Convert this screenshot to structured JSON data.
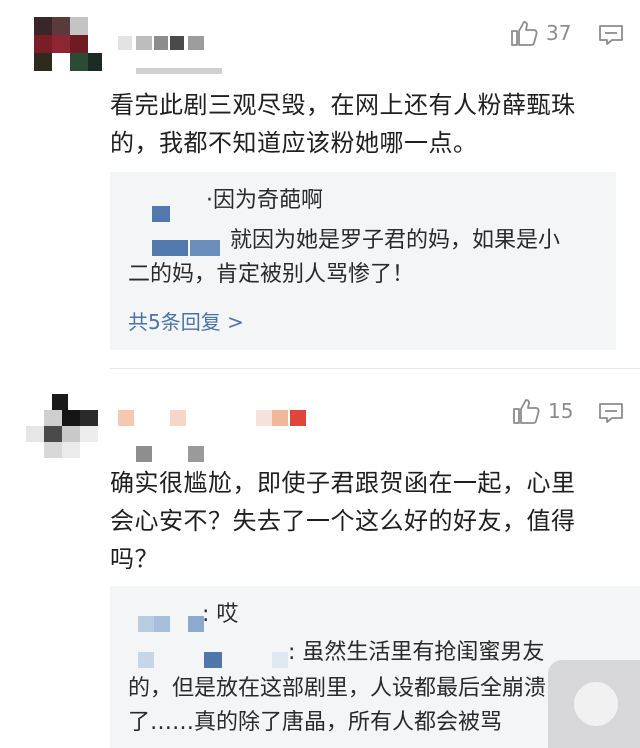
{
  "comments": [
    {
      "likes": "37",
      "text_line1": "看完此剧三观尽毁，在网上还有人粉薛甄珠",
      "text_line2": "的，我都不知道应该粉她哪一点。",
      "reply_author_suffix": "·因为奇葩啊",
      "reply_line1": "就因为她是罗子君的妈，如果是小",
      "reply_line2_prefix": "二",
      "reply_line2": "的妈，肯定被别人骂惨了！",
      "more_replies": "共5条回复 >"
    },
    {
      "likes": "15",
      "text_line1": "确实很尴尬，即使子君跟贺函在一起，心里",
      "text_line2": "会心安不？失去了一个这么好的好友，值得",
      "text_line3": "吗？",
      "reply1_suffix": ": 哎",
      "reply2_suffix": ": 虽然生活里有抢闺蜜男友",
      "reply2_line2": "的，但是放在这部剧里，人设都最后全崩溃",
      "reply2_line3": "了……真的除了唐晶，所有人都会被骂"
    }
  ],
  "colors": {
    "accent_link": "#4a73a8",
    "icon_gray": "#8c8c8c",
    "reply_bg": "#f4f5f6"
  },
  "icons": [
    "thumb-up-icon",
    "reply-icon"
  ]
}
